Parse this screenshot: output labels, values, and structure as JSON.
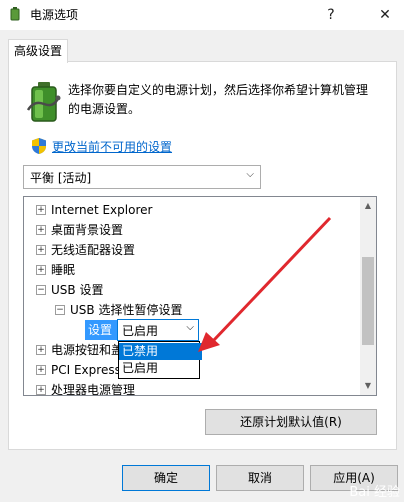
{
  "window": {
    "title": "电源选项",
    "help_label": "?",
    "close_label": "✕"
  },
  "tab": {
    "label": "高级设置"
  },
  "description": "选择你要自定义的电源计划，然后选择你希望计算机管理的电源设置。",
  "change_link": "更改当前不可用的设置",
  "plan_dropdown": {
    "value": "平衡 [活动]",
    "arrow": "⌵"
  },
  "tree": {
    "items": [
      {
        "label": "Internet Explorer",
        "toggle": "+"
      },
      {
        "label": "桌面背景设置",
        "toggle": "+"
      },
      {
        "label": "无线适配器设置",
        "toggle": "+"
      },
      {
        "label": "睡眠",
        "toggle": "+"
      },
      {
        "label": "USB 设置",
        "toggle": "−"
      },
      {
        "label": "USB 选择性暂停设置",
        "toggle": "−"
      },
      {
        "label": "电源按钮和盖",
        "toggle": "+"
      },
      {
        "label": "PCI Express",
        "toggle": "+"
      },
      {
        "label": "处理器电源管理",
        "toggle": "+"
      }
    ],
    "setting_label": "设置",
    "setting_value": "已启用",
    "options": [
      "已禁用",
      "已启用"
    ],
    "selected_option": "已禁用"
  },
  "buttons": {
    "restore": "还原计划默认值(R)",
    "ok": "确定",
    "cancel": "取消",
    "apply": "应用(A)"
  },
  "watermark": "Bai 经验",
  "colors": {
    "accent": "#0078d7",
    "highlight": "#3399ff",
    "link": "#0066cc",
    "arrow": "#e0282e"
  }
}
